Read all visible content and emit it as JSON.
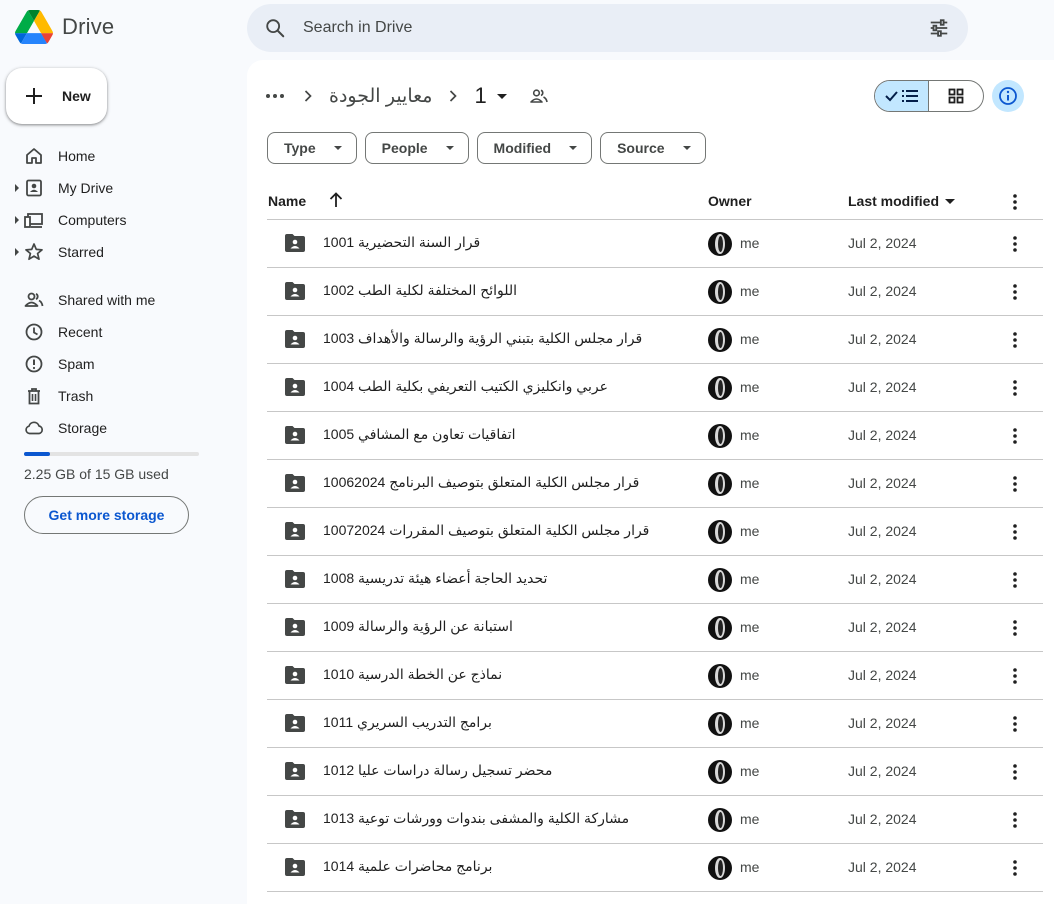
{
  "app": {
    "name": "Drive"
  },
  "search": {
    "placeholder": "Search in Drive"
  },
  "sidebar": {
    "new_label": "New",
    "items": [
      {
        "label": "Home",
        "icon": "home-icon"
      },
      {
        "label": "My Drive",
        "icon": "my-drive-icon"
      },
      {
        "label": "Computers",
        "icon": "computers-icon"
      },
      {
        "label": "Starred",
        "icon": "star-icon"
      },
      {
        "label": "Shared with me",
        "icon": "shared-icon"
      },
      {
        "label": "Recent",
        "icon": "clock-icon"
      },
      {
        "label": "Spam",
        "icon": "spam-icon"
      },
      {
        "label": "Trash",
        "icon": "trash-icon"
      },
      {
        "label": "Storage",
        "icon": "cloud-icon"
      }
    ],
    "storage_used_fraction": 0.15,
    "storage_text": "2.25 GB of 15 GB used",
    "get_storage_label": "Get more storage"
  },
  "breadcrumb": {
    "parent": "معايير الجودة",
    "current": "1"
  },
  "filters": [
    "Type",
    "People",
    "Modified",
    "Source"
  ],
  "table": {
    "col_name": "Name",
    "col_owner": "Owner",
    "col_modified": "Last modified",
    "rows": [
      {
        "name": "1001 قرار السنة التحضيرية",
        "owner": "me",
        "modified": "Jul 2, 2024"
      },
      {
        "name": "1002 اللوائح المختلفة لكلية الطب",
        "owner": "me",
        "modified": "Jul 2, 2024"
      },
      {
        "name": "1003 قرار مجلس الكلية بتبني الرؤية والرسالة والأهداف",
        "owner": "me",
        "modified": "Jul 2, 2024"
      },
      {
        "name": "1004  عربي وانكليزي الكتيب التعريفي بكلية الطب",
        "owner": "me",
        "modified": "Jul 2, 2024"
      },
      {
        "name": "1005  اتفاقيات تعاون مع المشافي",
        "owner": "me",
        "modified": "Jul 2, 2024"
      },
      {
        "name": "1006قرار مجلس الكلية المتعلق بتوصيف البرنامج 2024",
        "owner": "me",
        "modified": "Jul 2, 2024"
      },
      {
        "name": "1007قرار مجلس الكلية المتعلق بتوصيف المقررات 2024",
        "owner": "me",
        "modified": "Jul 2, 2024"
      },
      {
        "name": "1008 تحديد الحاجة أعضاء هيئة تدريسية",
        "owner": "me",
        "modified": "Jul 2, 2024"
      },
      {
        "name": "1009 استبانة عن الرؤية والرسالة",
        "owner": "me",
        "modified": "Jul 2, 2024"
      },
      {
        "name": "1010 نماذج عن الخطة الدرسية",
        "owner": "me",
        "modified": "Jul 2, 2024"
      },
      {
        "name": "1011 برامج التدريب السريري",
        "owner": "me",
        "modified": "Jul 2, 2024"
      },
      {
        "name": "1012 محضر تسجيل رسالة دراسات عليا",
        "owner": "me",
        "modified": "Jul 2, 2024"
      },
      {
        "name": "1013 مشاركة الكلية والمشفى بندوات وورشات توعية",
        "owner": "me",
        "modified": "Jul 2, 2024"
      },
      {
        "name": "1014 برنامج محاضرات علمية",
        "owner": "me",
        "modified": "Jul 2, 2024"
      }
    ]
  }
}
